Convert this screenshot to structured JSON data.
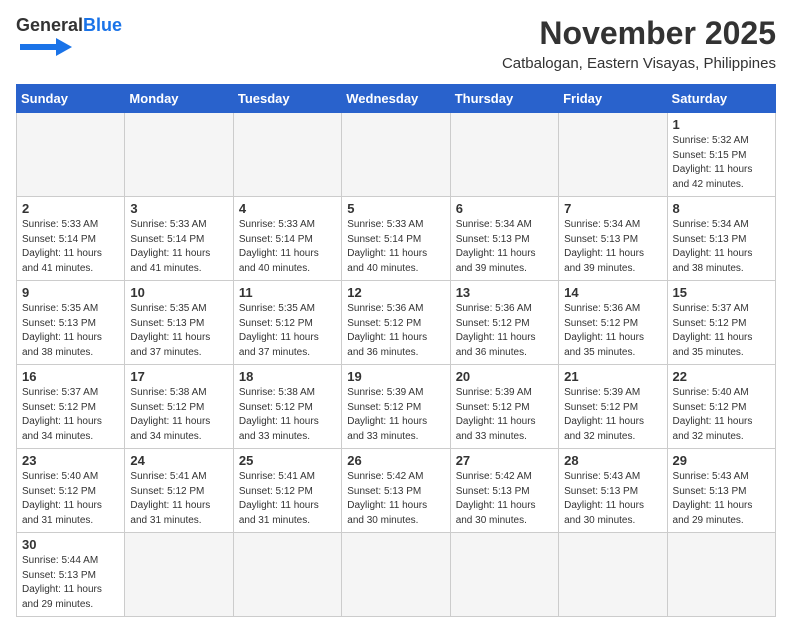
{
  "header": {
    "logo_text_general": "General",
    "logo_text_blue": "Blue",
    "month_title": "November 2025",
    "location": "Catbalogan, Eastern Visayas, Philippines"
  },
  "weekdays": [
    "Sunday",
    "Monday",
    "Tuesday",
    "Wednesday",
    "Thursday",
    "Friday",
    "Saturday"
  ],
  "days": [
    {
      "date": 1,
      "sunrise": "5:32 AM",
      "sunset": "5:15 PM",
      "daylight": "11 hours and 42 minutes."
    },
    {
      "date": 2,
      "sunrise": "5:33 AM",
      "sunset": "5:14 PM",
      "daylight": "11 hours and 41 minutes."
    },
    {
      "date": 3,
      "sunrise": "5:33 AM",
      "sunset": "5:14 PM",
      "daylight": "11 hours and 41 minutes."
    },
    {
      "date": 4,
      "sunrise": "5:33 AM",
      "sunset": "5:14 PM",
      "daylight": "11 hours and 40 minutes."
    },
    {
      "date": 5,
      "sunrise": "5:33 AM",
      "sunset": "5:14 PM",
      "daylight": "11 hours and 40 minutes."
    },
    {
      "date": 6,
      "sunrise": "5:34 AM",
      "sunset": "5:13 PM",
      "daylight": "11 hours and 39 minutes."
    },
    {
      "date": 7,
      "sunrise": "5:34 AM",
      "sunset": "5:13 PM",
      "daylight": "11 hours and 39 minutes."
    },
    {
      "date": 8,
      "sunrise": "5:34 AM",
      "sunset": "5:13 PM",
      "daylight": "11 hours and 38 minutes."
    },
    {
      "date": 9,
      "sunrise": "5:35 AM",
      "sunset": "5:13 PM",
      "daylight": "11 hours and 38 minutes."
    },
    {
      "date": 10,
      "sunrise": "5:35 AM",
      "sunset": "5:13 PM",
      "daylight": "11 hours and 37 minutes."
    },
    {
      "date": 11,
      "sunrise": "5:35 AM",
      "sunset": "5:12 PM",
      "daylight": "11 hours and 37 minutes."
    },
    {
      "date": 12,
      "sunrise": "5:36 AM",
      "sunset": "5:12 PM",
      "daylight": "11 hours and 36 minutes."
    },
    {
      "date": 13,
      "sunrise": "5:36 AM",
      "sunset": "5:12 PM",
      "daylight": "11 hours and 36 minutes."
    },
    {
      "date": 14,
      "sunrise": "5:36 AM",
      "sunset": "5:12 PM",
      "daylight": "11 hours and 35 minutes."
    },
    {
      "date": 15,
      "sunrise": "5:37 AM",
      "sunset": "5:12 PM",
      "daylight": "11 hours and 35 minutes."
    },
    {
      "date": 16,
      "sunrise": "5:37 AM",
      "sunset": "5:12 PM",
      "daylight": "11 hours and 34 minutes."
    },
    {
      "date": 17,
      "sunrise": "5:38 AM",
      "sunset": "5:12 PM",
      "daylight": "11 hours and 34 minutes."
    },
    {
      "date": 18,
      "sunrise": "5:38 AM",
      "sunset": "5:12 PM",
      "daylight": "11 hours and 33 minutes."
    },
    {
      "date": 19,
      "sunrise": "5:39 AM",
      "sunset": "5:12 PM",
      "daylight": "11 hours and 33 minutes."
    },
    {
      "date": 20,
      "sunrise": "5:39 AM",
      "sunset": "5:12 PM",
      "daylight": "11 hours and 33 minutes."
    },
    {
      "date": 21,
      "sunrise": "5:39 AM",
      "sunset": "5:12 PM",
      "daylight": "11 hours and 32 minutes."
    },
    {
      "date": 22,
      "sunrise": "5:40 AM",
      "sunset": "5:12 PM",
      "daylight": "11 hours and 32 minutes."
    },
    {
      "date": 23,
      "sunrise": "5:40 AM",
      "sunset": "5:12 PM",
      "daylight": "11 hours and 31 minutes."
    },
    {
      "date": 24,
      "sunrise": "5:41 AM",
      "sunset": "5:12 PM",
      "daylight": "11 hours and 31 minutes."
    },
    {
      "date": 25,
      "sunrise": "5:41 AM",
      "sunset": "5:12 PM",
      "daylight": "11 hours and 31 minutes."
    },
    {
      "date": 26,
      "sunrise": "5:42 AM",
      "sunset": "5:13 PM",
      "daylight": "11 hours and 30 minutes."
    },
    {
      "date": 27,
      "sunrise": "5:42 AM",
      "sunset": "5:13 PM",
      "daylight": "11 hours and 30 minutes."
    },
    {
      "date": 28,
      "sunrise": "5:43 AM",
      "sunset": "5:13 PM",
      "daylight": "11 hours and 30 minutes."
    },
    {
      "date": 29,
      "sunrise": "5:43 AM",
      "sunset": "5:13 PM",
      "daylight": "11 hours and 29 minutes."
    },
    {
      "date": 30,
      "sunrise": "5:44 AM",
      "sunset": "5:13 PM",
      "daylight": "11 hours and 29 minutes."
    }
  ],
  "labels": {
    "sunrise": "Sunrise:",
    "sunset": "Sunset:",
    "daylight": "Daylight:"
  }
}
